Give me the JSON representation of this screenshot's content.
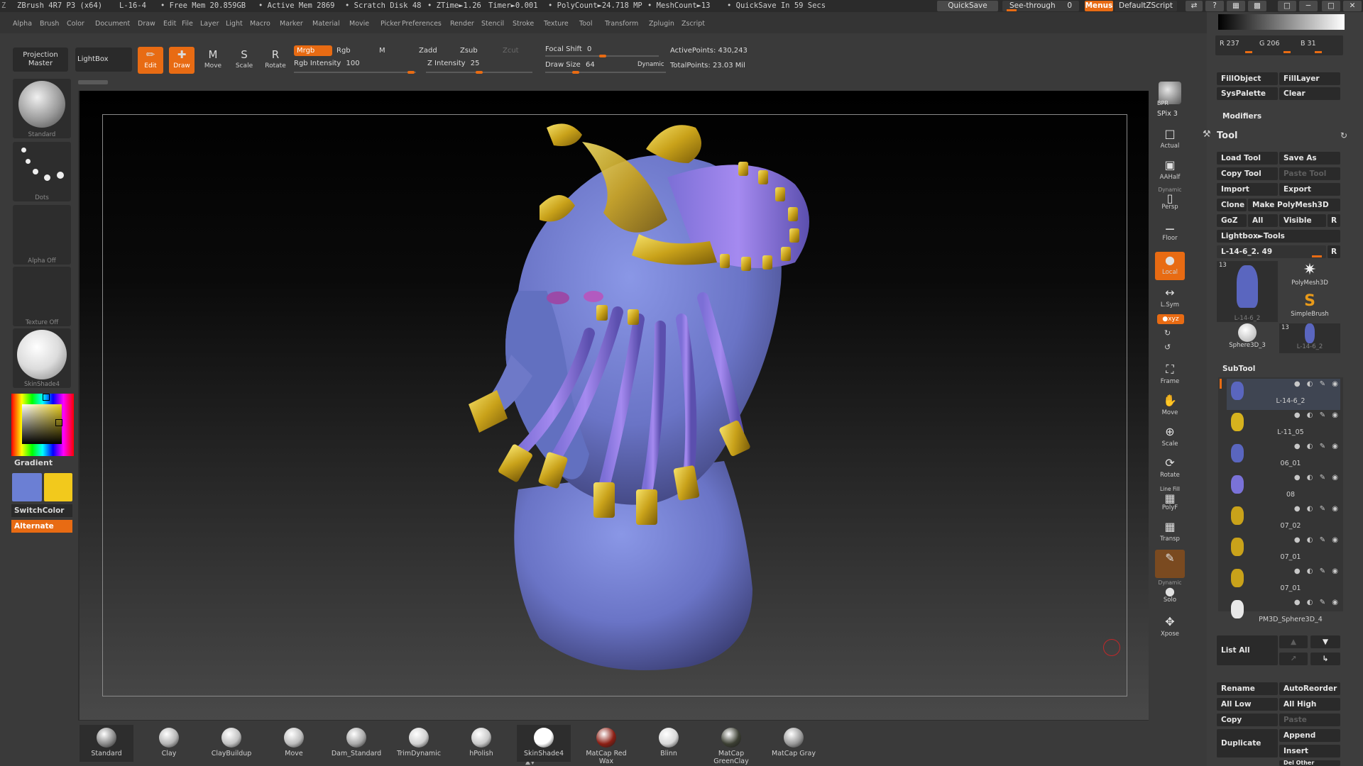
{
  "titlebar": {
    "app": "ZBrush 4R7 P3 (x64)",
    "doc": "L-16-4",
    "free_mem": "• Free Mem 20.859GB",
    "active_mem": "• Active Mem 2869",
    "scratch": "• Scratch Disk 48",
    "ztime": "• ZTime►1.26",
    "timer": "Timer►0.001",
    "polycount": "• PolyCount►24.718 MP",
    "meshcount": "• MeshCount►13",
    "quicksave_msg": "• QuickSave In 59 Secs",
    "quicksave_btn": "QuickSave",
    "seethrough": "See-through",
    "seethrough_val": "0",
    "menus_btn": "Menus",
    "script_btn": "DefaultZScript"
  },
  "menus": [
    "Alpha",
    "Brush",
    "Color",
    "Document",
    "Draw",
    "Edit",
    "File",
    "Layer",
    "Light",
    "Macro",
    "Marker",
    "Material",
    "Movie",
    "Picker",
    "Preferences",
    "Render",
    "Stencil",
    "Stroke",
    "Texture",
    "Tool",
    "Transform",
    "Zplugin",
    "Zscript"
  ],
  "toolbar": {
    "projection_master": "Projection Master",
    "lightbox": "LightBox",
    "edit": "Edit",
    "draw": "Draw",
    "move": "Move",
    "scale": "Scale",
    "rotate": "Rotate",
    "mrgb": "Mrgb",
    "rgb": "Rgb",
    "m": "M",
    "zadd": "Zadd",
    "zsub": "Zsub",
    "zcut": "Zcut",
    "rgb_intensity_label": "Rgb Intensity",
    "rgb_intensity": "100",
    "z_intensity_label": "Z Intensity",
    "z_intensity": "25",
    "focal_shift_label": "Focal Shift",
    "focal_shift": "0",
    "draw_size_label": "Draw Size",
    "draw_size": "64",
    "dynamic": "Dynamic",
    "active_points": "ActivePoints: 430,243",
    "total_points": "TotalPoints: 23.03 Mil"
  },
  "left": {
    "brush": "Standard",
    "stroke": "Dots",
    "alpha": "Alpha Off",
    "texture": "Texture Off",
    "material": "SkinShade4",
    "gradient": "Gradient",
    "switch_color": "SwitchColor",
    "alternate": "Alternate",
    "colors": {
      "primary": "#6b7fd4",
      "secondary": "#f2c91c"
    }
  },
  "right_shelf": {
    "bpr": "BPR",
    "spix": "SPix 3",
    "actual": "Actual",
    "aahalf": "AAHalf",
    "dynamic": "Dynamic",
    "persp": "Persp",
    "floor": "Floor",
    "local": "Local",
    "lsym": "L.Sym",
    "xyz": "●xyz",
    "frame": "Frame",
    "move": "Move",
    "scale": "Scale",
    "rotate": "Rotate",
    "linefill": "Line Fill",
    "polyf": "PolyF",
    "transp": "Transp",
    "dynamic2": "Dynamic",
    "solo": "Solo",
    "xpose": "Xpose"
  },
  "panel": {
    "r": "R 237",
    "g": "G 206",
    "b": "B 31",
    "fill_object": "FillObject",
    "fill_layer": "FillLayer",
    "sys_palette": "SysPalette",
    "clear": "Clear",
    "modifiers": "Modifiers",
    "tool_title": "Tool",
    "load_tool": "Load Tool",
    "save_as": "Save As",
    "copy_tool": "Copy Tool",
    "paste_tool": "Paste Tool",
    "import": "Import",
    "export": "Export",
    "clone": "Clone",
    "make_polymesh": "Make PolyMesh3D",
    "goz": "GoZ",
    "all": "All",
    "visible": "Visible",
    "r_btn": "R",
    "lightbox_tools": "Lightbox►Tools",
    "current_tool": "L-14-6_2. 49",
    "tool_count": "13",
    "tools": [
      "L-14-6_2",
      "PolyMesh3D",
      "SimpleBrush",
      "Sphere3D_3",
      "L-14-6_2"
    ],
    "subtool_title": "SubTool",
    "subtools": [
      "L-14-6_2",
      "L-11_05",
      "06_01",
      "08",
      "07_02",
      "07_01",
      "07_01",
      "PM3D_Sphere3D_4"
    ],
    "list_all": "List All",
    "rename": "Rename",
    "auto_reorder": "AutoReorder",
    "all_low": "All Low",
    "all_high": "All High",
    "copy": "Copy",
    "paste": "Paste",
    "duplicate": "Duplicate",
    "append": "Append",
    "insert": "Insert",
    "del_other": "Del Other"
  },
  "bottom_materials": [
    {
      "name": "Standard",
      "color": "#8a8a8a"
    },
    {
      "name": "Clay",
      "color": "#b5b5b5"
    },
    {
      "name": "ClayBuildup",
      "color": "#c2c2c2"
    },
    {
      "name": "Move",
      "color": "#bdbdbd"
    },
    {
      "name": "Dam_Standard",
      "color": "#a8a8a8"
    },
    {
      "name": "TrimDynamic",
      "color": "#d0d0d0"
    },
    {
      "name": "hPolish",
      "color": "#c9c9c9"
    },
    {
      "name": "SkinShade4",
      "color": "#ffffff"
    },
    {
      "name": "MatCap Red Wax",
      "color": "#8c1f14"
    },
    {
      "name": "Blinn",
      "color": "#d8d8d8"
    },
    {
      "name": "MatCap GreenClay",
      "color": "#3c3f33"
    },
    {
      "name": "MatCap Gray",
      "color": "#9a9a9a"
    }
  ]
}
